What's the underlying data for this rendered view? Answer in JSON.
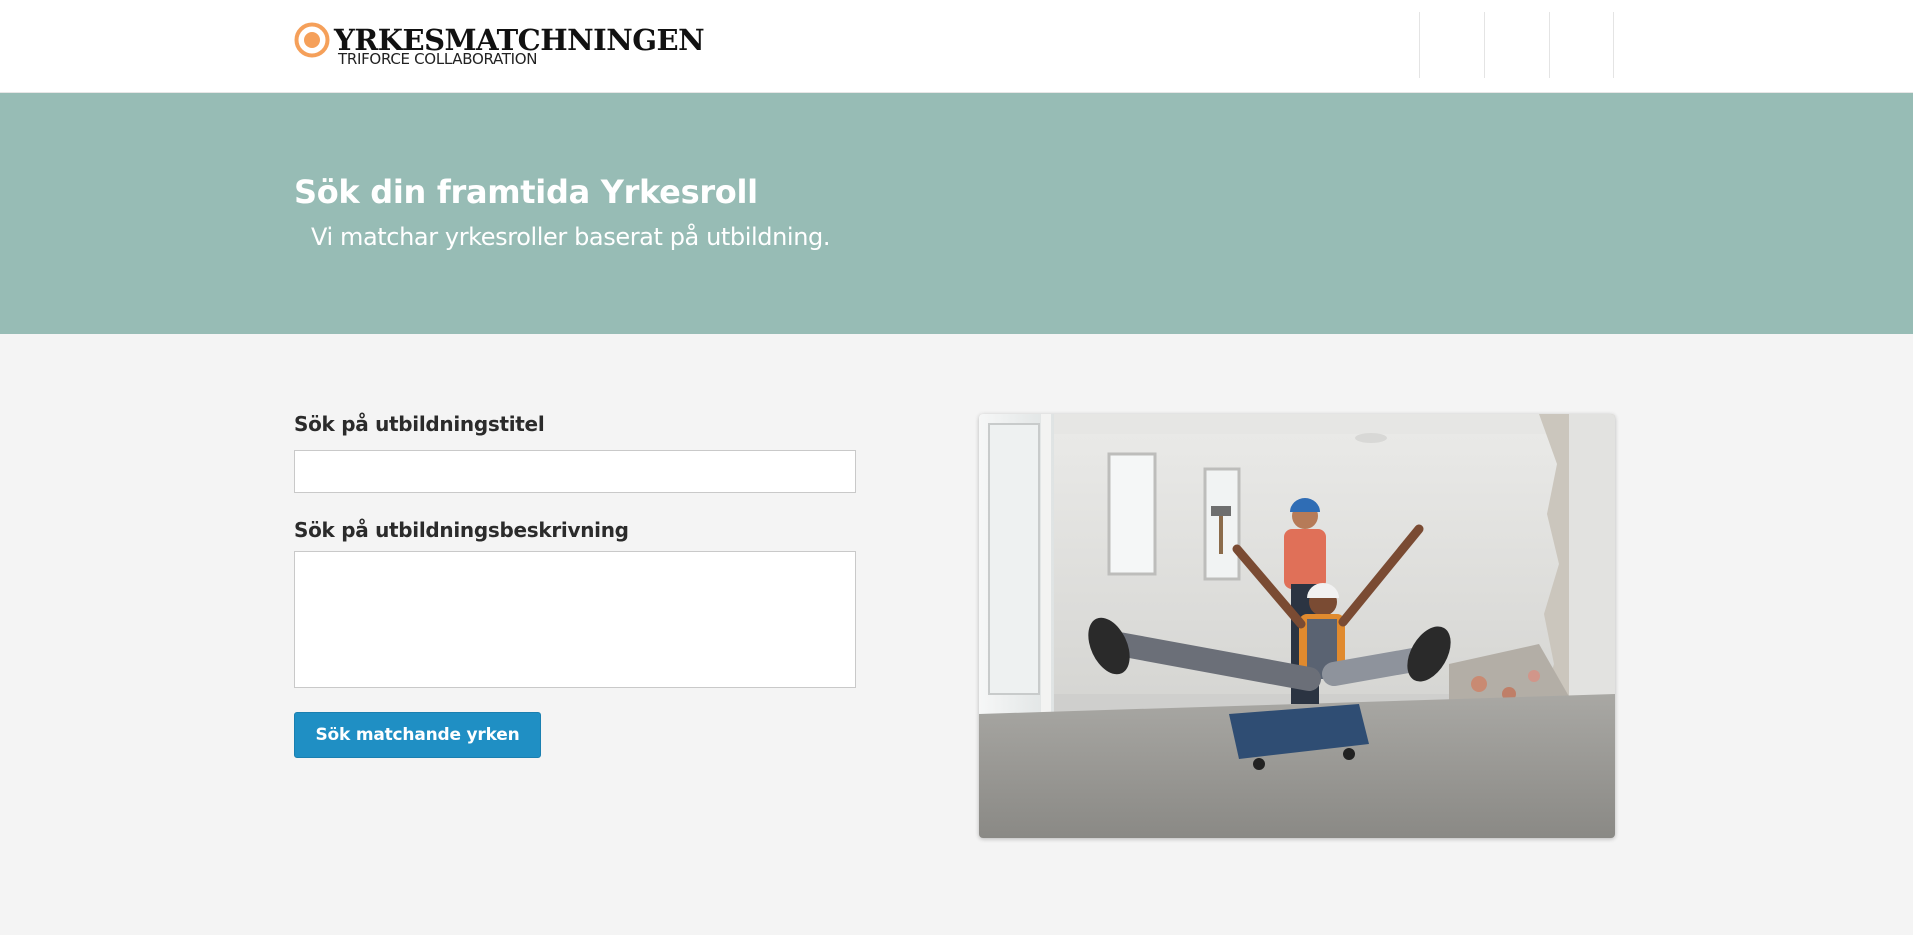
{
  "header": {
    "logo_title": "YRKESMATCHNINGEN",
    "logo_subtitle": "TRIFORCE COLLABORATION",
    "brand_color": "#f5a05a"
  },
  "hero": {
    "title": "Sök din framtida Yrkesroll",
    "subtitle": "Vi matchar yrkesroller baserat på utbildning.",
    "background_color": "#97bcb5"
  },
  "form": {
    "title_label": "Sök på utbildningstitel",
    "title_value": "",
    "description_label": "Sök på utbildningsbeskrivning",
    "description_value": "",
    "submit_label": "Sök matchande yrken",
    "button_color": "#1f8fc4"
  },
  "image": {
    "icon": "construction-workers-photo"
  }
}
